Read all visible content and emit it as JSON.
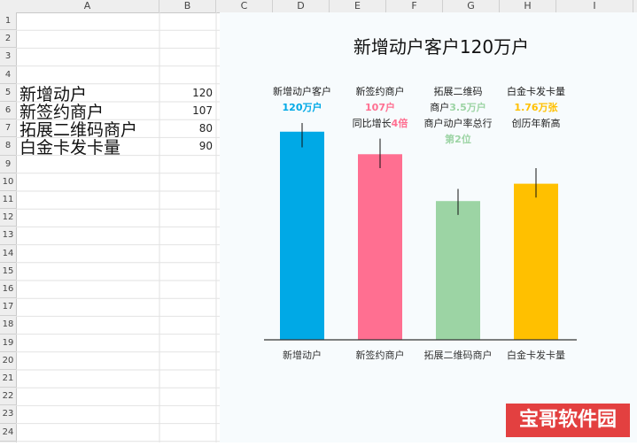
{
  "sheet": {
    "columns": [
      "A",
      "B",
      "C",
      "D",
      "E",
      "F",
      "G",
      "H",
      "I"
    ],
    "rows": [
      "1",
      "2",
      "3",
      "4",
      "5",
      "6",
      "7",
      "8",
      "9",
      "10",
      "11",
      "12",
      "13",
      "14",
      "15",
      "16",
      "17",
      "18",
      "19",
      "20",
      "21",
      "22",
      "23",
      "24"
    ],
    "cells": [
      {
        "label": "新增动户",
        "value": "120"
      },
      {
        "label": "新签约商户",
        "value": "107"
      },
      {
        "label": "拓展二维码商户",
        "value": "80"
      },
      {
        "label": "白金卡发卡量",
        "value": "90"
      }
    ]
  },
  "chart_data": {
    "type": "bar",
    "title": "新增动户客户120万户",
    "categories": [
      "新增动户",
      "新签约商户",
      "拓展二维码商户",
      "白金卡发卡量"
    ],
    "values": [
      120,
      107,
      80,
      90
    ],
    "colors": [
      "#00a9e6",
      "#ff6f91",
      "#9cd4a4",
      "#ffc000"
    ],
    "ylim": [
      0,
      125
    ],
    "annotations": [
      {
        "lines": [
          {
            "text": "新增动户客户",
            "color": "#222222"
          },
          {
            "text": "120万户",
            "color": "#00a9e6",
            "bold": true
          }
        ]
      },
      {
        "lines": [
          {
            "text": "新签约商户",
            "color": "#222222"
          },
          {
            "text": "107户",
            "color": "#ff6f91",
            "bold": true
          },
          {
            "text": "同比增长",
            "color": "#222222",
            "suffix": "4倍",
            "suffixColor": "#ff6f91"
          }
        ]
      },
      {
        "lines": [
          {
            "text": "拓展二维码",
            "color": "#222222"
          },
          {
            "text": "商户",
            "color": "#222222",
            "suffix": "3.5万户",
            "suffixColor": "#9cd4a4"
          },
          {
            "text": "商户动户率总行",
            "color": "#222222"
          },
          {
            "text": "第2位",
            "color": "#9cd4a4",
            "bold": true
          }
        ]
      },
      {
        "lines": [
          {
            "text": "白金卡发卡量",
            "color": "#222222"
          },
          {
            "text": "1.76万张",
            "color": "#ffc000",
            "bold": true
          },
          {
            "text": "创历年新高",
            "color": "#222222"
          }
        ]
      }
    ],
    "error_bars": [
      [
        111,
        125
      ],
      [
        99,
        116
      ],
      [
        72,
        87
      ],
      [
        82,
        99
      ]
    ]
  },
  "watermark": "宝哥软件园"
}
